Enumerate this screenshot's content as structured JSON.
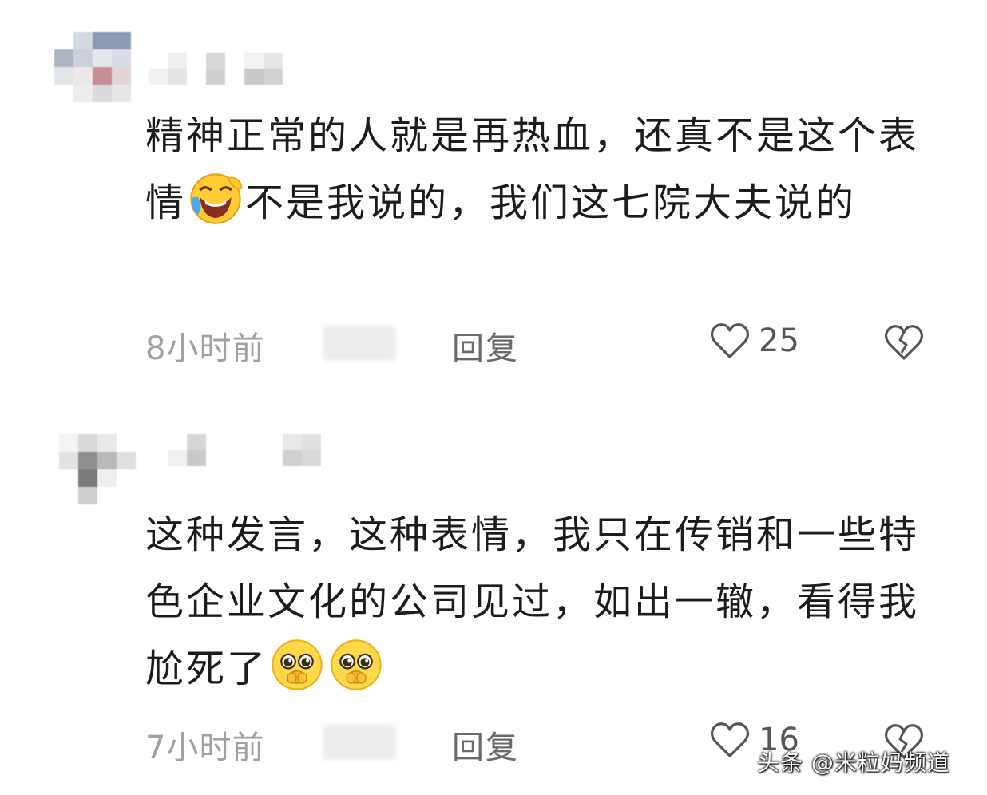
{
  "comments": [
    {
      "text_before_emoji": "精神正常的人就是再热血，还真不是这个表情",
      "emoji": "laughing-crying-face",
      "text_after_emoji": "不是我说的，我们这七院大夫说的",
      "time": "8小时前",
      "reply_label": "回复",
      "likes": "25"
    },
    {
      "text_before_emoji": "这种发言，这种表情，我只在传销和一些特色企业文化的公司见过，如出一辙，看得我尬死了",
      "emoji": "pleading-face",
      "text_after_emoji": "",
      "time": "7小时前",
      "reply_label": "回复",
      "likes": "16"
    }
  ],
  "watermark": "头条 @米粒妈频道",
  "colors": {
    "text": "#1c1c1c",
    "meta": "#8a8a8a",
    "background": "#ffffff"
  }
}
